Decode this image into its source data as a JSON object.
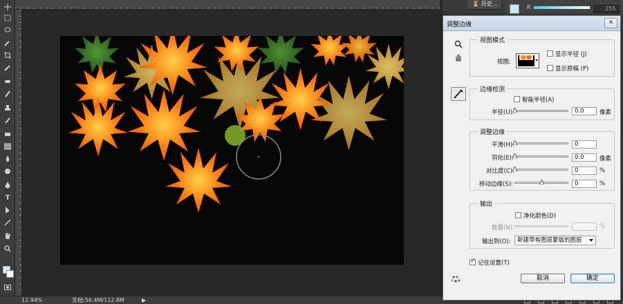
{
  "status": {
    "zoom": "12.94%",
    "doc_info": "文档:56.4M/112.8M"
  },
  "history_tab": {
    "label": "历史..."
  },
  "color_panel": {
    "channel": "R",
    "value": "255"
  },
  "toolbar": {
    "icons": [
      "move-tool-icon",
      "marquee-tool-icon",
      "lasso-tool-icon",
      "quick-select-tool-icon",
      "crop-tool-icon",
      "eyedropper-tool-icon",
      "healing-brush-icon",
      "brush-tool-icon",
      "clone-stamp-icon",
      "history-brush-icon",
      "eraser-tool-icon",
      "gradient-tool-icon",
      "blur-tool-icon",
      "dodge-tool-icon",
      "pen-tool-icon",
      "type-tool-icon",
      "path-select-icon",
      "shape-tool-icon",
      "hand-tool-icon",
      "zoom-tool-icon"
    ],
    "type_tool_glyph": "T"
  },
  "dialog": {
    "title": "调整边缘",
    "close_glyph": "✕",
    "view_mode": {
      "title": "视图模式",
      "view_label": "视图:",
      "show_radius": "显示半径 (J)",
      "show_original": "显示原稿 (P)",
      "show_radius_checked": false,
      "show_original_checked": false
    },
    "edge_detection": {
      "title": "边缘检测",
      "smart_radius": "智能半径(A)",
      "smart_radius_checked": false,
      "radius_label": "半径(U):",
      "radius_value": "0.0",
      "radius_unit": "像素"
    },
    "adjust_edge": {
      "title": "调整边缘",
      "rows": [
        {
          "label": "平滑(H):",
          "value": "0",
          "unit": "",
          "level": 0
        },
        {
          "label": "羽化(E):",
          "value": "0.0",
          "unit": "像素",
          "level": 0
        },
        {
          "label": "对比度(C):",
          "value": "0",
          "unit": "%",
          "level": 0
        },
        {
          "label": "移动边缘(S):",
          "value": "0",
          "unit": "%",
          "level": 0.5
        }
      ]
    },
    "output": {
      "title": "输出",
      "decontaminate": "净化颜色(D)",
      "decontaminate_checked": false,
      "amount_label": "数量(N):",
      "amount_unit": "%",
      "output_to_label": "输出到(O):",
      "output_to_value": "新建带有图层蒙版的图层"
    },
    "remember": {
      "label": "记住设置(T)",
      "checked": true
    },
    "cancel": "取消",
    "ok": "确定"
  },
  "colors": {
    "canvas_bg": "#060606",
    "workspace": "#282828",
    "dialog_bg": "#f0f0f0",
    "leaf_orange": "#ff6a10",
    "leaf_yellow": "#f4b428"
  }
}
